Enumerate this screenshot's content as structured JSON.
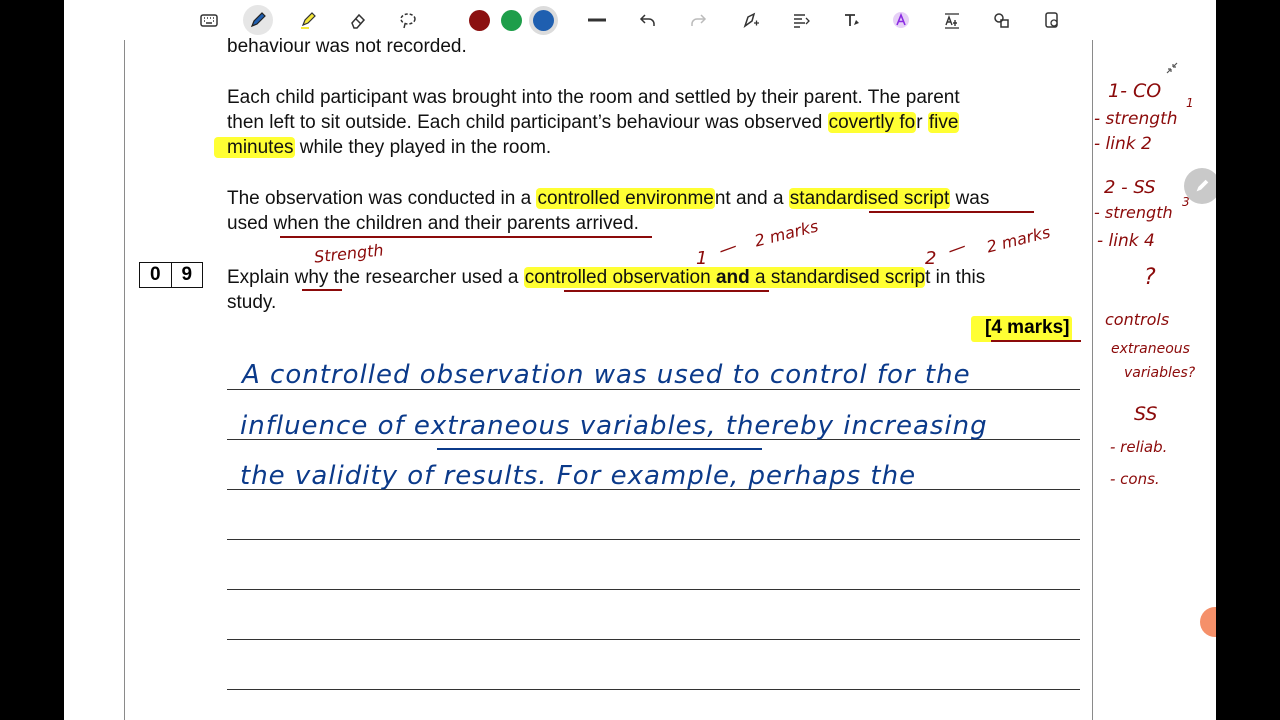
{
  "toolbar": {
    "tools": [
      "keyboard-icon",
      "pen-icon",
      "highlighter-icon",
      "eraser-icon",
      "lasso-icon"
    ],
    "colors": [
      "#8b1010",
      "#1e9e4a",
      "#1f5fb0"
    ],
    "selected_color": "#1f5fb0"
  },
  "document": {
    "line0": "behaviour was not recorded.",
    "p1_l1": "Each child participant was brought into the room and settled by their parent.  The parent",
    "p1_l2a": "then left to sit outside.  Each child participant’s behaviour was observed ",
    "p1_l2b": "covertly fo",
    "p1_l2c": "r ",
    "p1_l2d": "five",
    "p1_l3a": "minutes",
    "p1_l3b": " while they played in the room.",
    "p2_l1a": "The observation was conducted in a ",
    "p2_l1b": "controlled environme",
    "p2_l1c": "nt and a ",
    "p2_l1d": "standardised script",
    "p2_l1e": " was",
    "p2_l2": "used when the children and their parents arrived.",
    "q_digit1": "0",
    "q_digit2": "9",
    "q_l1a": "Explain why the researcher used a ",
    "q_l1b": "controlled observation",
    "q_l1c": " and",
    "q_l1d": " a standardised scrip",
    "q_l1e": "t in this",
    "q_l2": "study.",
    "marks": "[4 marks]"
  },
  "answer": {
    "line1": "A controlled observation was used to control for the",
    "line2": "influence of extraneous variables, thereby increasing",
    "line3": "the validity of results. For example, perhaps the"
  },
  "annotations": {
    "strength": "Strength",
    "one": "1",
    "dash1": "—",
    "two_marks_a": "2 marks",
    "two": "2",
    "dash2": "—",
    "two_marks_b": "2 marks",
    "side": [
      "1- CO",
      "- strength",
      "- link 2",
      "2 - SS",
      "- strength",
      "- link 4",
      "?",
      "controls",
      "extraneous",
      "variables?",
      "SS",
      "- reliab.",
      "- cons."
    ],
    "sup1": "1",
    "sup3": "3"
  }
}
